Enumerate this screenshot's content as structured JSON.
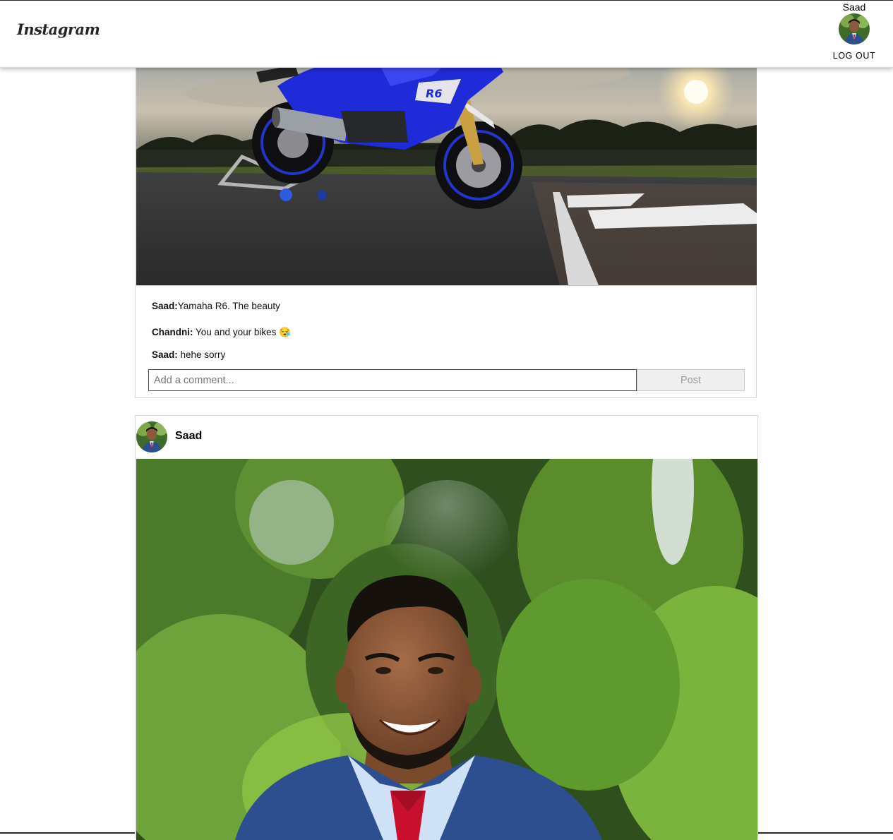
{
  "header": {
    "logo_text": "Instagram",
    "username": "Saad",
    "logout_label": "LOG OUT"
  },
  "posts": [
    {
      "image_alt": "Yamaha R6 motorcycle on race track at sunset",
      "comments": [
        {
          "user": "Saad:",
          "text": "Yamaha R6. The beauty"
        },
        {
          "user": "Chandni:",
          "text": " You and your bikes 😪"
        },
        {
          "user": "Saad:",
          "text": " hehe sorry"
        }
      ],
      "comment_placeholder": "Add a comment...",
      "post_button_label": "Post"
    },
    {
      "username": "Saad",
      "image_alt": "Portrait of Saad in blue suit and red tie in front of green trees"
    }
  ],
  "colors": {
    "bike_blue": "#1f2ad8",
    "suit_blue": "#2d4f8f",
    "tie_red": "#c8102e",
    "foliage_green": "#5f9a2b"
  }
}
